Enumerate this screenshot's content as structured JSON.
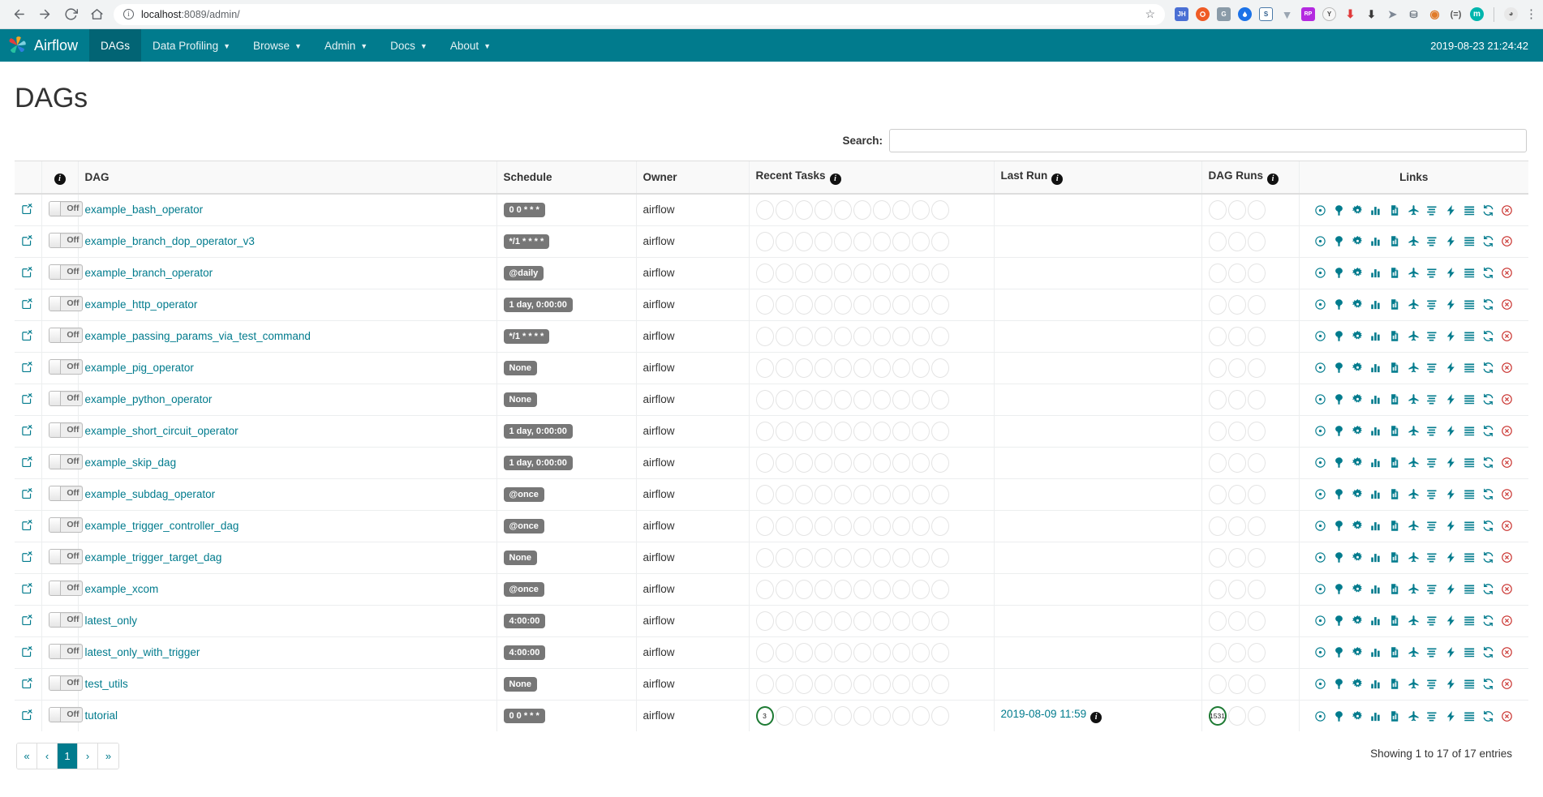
{
  "browser": {
    "back_icon": "back-arrow-icon",
    "forward_icon": "forward-arrow-icon",
    "reload_icon": "reload-icon",
    "home_icon": "home-icon",
    "url_host": "localhost",
    "url_rest": ":8089/admin/",
    "url_full": "localhost:8089/admin/",
    "star_glyph": "☆",
    "kebab_glyph": "⋮",
    "extensions": [
      {
        "name": "extension-jh",
        "label": "JH",
        "color": "#4a6fd4"
      },
      {
        "name": "extension-lifebuoy",
        "label": "",
        "color": "#ef5b25"
      },
      {
        "name": "extension-translate",
        "label": "G",
        "color": "#8a9ba8"
      },
      {
        "name": "extension-blue-drop",
        "label": "",
        "color": "#1b72e8"
      },
      {
        "name": "extension-s",
        "label": "S",
        "color": "#5a7fa6"
      },
      {
        "name": "extension-v",
        "label": "V",
        "color": "#9aa5b1"
      },
      {
        "name": "extension-rp",
        "label": "RP",
        "color": "#b42ae0"
      },
      {
        "name": "extension-y-circle",
        "label": "Y",
        "color": "#f5f5f5"
      },
      {
        "name": "extension-download-arrow",
        "label": "",
        "color": "#e03a3a"
      },
      {
        "name": "extension-dark-arrow",
        "label": "",
        "color": "#3a3a3a"
      },
      {
        "name": "extension-cursor",
        "label": "",
        "color": "#7d8794"
      },
      {
        "name": "extension-sitemap",
        "label": "",
        "color": "#6b7580"
      },
      {
        "name": "extension-eye",
        "label": "",
        "color": "#e07b2a"
      },
      {
        "name": "extension-equals",
        "label": "=",
        "color": "#555555"
      },
      {
        "name": "extension-m-circle",
        "label": "m",
        "color": "#00b5ad"
      }
    ],
    "profile_icon": "profile-avatar-icon"
  },
  "navbar": {
    "brand": "Airflow",
    "items": [
      {
        "label": "DAGs",
        "has_caret": false,
        "active": true,
        "name": "nav-dags"
      },
      {
        "label": "Data Profiling",
        "has_caret": true,
        "active": false,
        "name": "nav-data-profiling"
      },
      {
        "label": "Browse",
        "has_caret": true,
        "active": false,
        "name": "nav-browse"
      },
      {
        "label": "Admin",
        "has_caret": true,
        "active": false,
        "name": "nav-admin"
      },
      {
        "label": "Docs",
        "has_caret": true,
        "active": false,
        "name": "nav-docs"
      },
      {
        "label": "About",
        "has_caret": true,
        "active": false,
        "name": "nav-about"
      }
    ],
    "caret_glyph": "▼",
    "clock": "2019-08-23 21:24:42"
  },
  "page": {
    "title": "DAGs"
  },
  "search": {
    "label": "Search:",
    "value": "",
    "placeholder": ""
  },
  "table": {
    "headers": {
      "edit": "",
      "info": "ⓘ",
      "dag": "DAG",
      "schedule": "Schedule",
      "owner": "Owner",
      "recent_tasks": "Recent Tasks",
      "last_run": "Last Run",
      "dag_runs": "DAG Runs",
      "links": "Links"
    },
    "toggle_label": "Off",
    "recent_task_slots": 10,
    "dag_run_slots": 3,
    "link_icons": [
      {
        "name": "trigger-dag-icon",
        "title": "Trigger Dag",
        "danger": false
      },
      {
        "name": "tree-view-icon",
        "title": "Tree View",
        "danger": false
      },
      {
        "name": "graph-view-icon",
        "title": "Graph View",
        "danger": false
      },
      {
        "name": "task-duration-icon",
        "title": "Task Duration",
        "danger": false
      },
      {
        "name": "task-tries-icon",
        "title": "Task Tries",
        "danger": false
      },
      {
        "name": "landing-times-icon",
        "title": "Landing Times",
        "danger": false
      },
      {
        "name": "gantt-icon",
        "title": "Gantt",
        "danger": false
      },
      {
        "name": "code-icon",
        "title": "Code",
        "danger": false
      },
      {
        "name": "logs-icon",
        "title": "Logs",
        "danger": false
      },
      {
        "name": "refresh-icon",
        "title": "Refresh",
        "danger": false
      },
      {
        "name": "delete-dag-icon",
        "title": "Delete Dag",
        "danger": true
      }
    ],
    "rows": [
      {
        "dag": "example_bash_operator",
        "schedule": "0 0 * * *",
        "owner": "airflow",
        "last_run": "",
        "recent": [],
        "runs": []
      },
      {
        "dag": "example_branch_dop_operator_v3",
        "schedule": "*/1 * * * *",
        "owner": "airflow",
        "last_run": "",
        "recent": [],
        "runs": []
      },
      {
        "dag": "example_branch_operator",
        "schedule": "@daily",
        "owner": "airflow",
        "last_run": "",
        "recent": [],
        "runs": []
      },
      {
        "dag": "example_http_operator",
        "schedule": "1 day, 0:00:00",
        "owner": "airflow",
        "last_run": "",
        "recent": [],
        "runs": []
      },
      {
        "dag": "example_passing_params_via_test_command",
        "schedule": "*/1 * * * *",
        "owner": "airflow",
        "last_run": "",
        "recent": [],
        "runs": []
      },
      {
        "dag": "example_pig_operator",
        "schedule": "None",
        "owner": "airflow",
        "last_run": "",
        "recent": [],
        "runs": []
      },
      {
        "dag": "example_python_operator",
        "schedule": "None",
        "owner": "airflow",
        "last_run": "",
        "recent": [],
        "runs": []
      },
      {
        "dag": "example_short_circuit_operator",
        "schedule": "1 day, 0:00:00",
        "owner": "airflow",
        "last_run": "",
        "recent": [],
        "runs": []
      },
      {
        "dag": "example_skip_dag",
        "schedule": "1 day, 0:00:00",
        "owner": "airflow",
        "last_run": "",
        "recent": [],
        "runs": []
      },
      {
        "dag": "example_subdag_operator",
        "schedule": "@once",
        "owner": "airflow",
        "last_run": "",
        "recent": [],
        "runs": []
      },
      {
        "dag": "example_trigger_controller_dag",
        "schedule": "@once",
        "owner": "airflow",
        "last_run": "",
        "recent": [],
        "runs": []
      },
      {
        "dag": "example_trigger_target_dag",
        "schedule": "None",
        "owner": "airflow",
        "last_run": "",
        "recent": [],
        "runs": []
      },
      {
        "dag": "example_xcom",
        "schedule": "@once",
        "owner": "airflow",
        "last_run": "",
        "recent": [],
        "runs": []
      },
      {
        "dag": "latest_only",
        "schedule": "4:00:00",
        "owner": "airflow",
        "last_run": "",
        "recent": [],
        "runs": []
      },
      {
        "dag": "latest_only_with_trigger",
        "schedule": "4:00:00",
        "owner": "airflow",
        "last_run": "",
        "recent": [],
        "runs": []
      },
      {
        "dag": "test_utils",
        "schedule": "None",
        "owner": "airflow",
        "last_run": "",
        "recent": [],
        "runs": []
      },
      {
        "dag": "tutorial",
        "schedule": "0 0 * * *",
        "owner": "airflow",
        "last_run": "2019-08-09 11:59",
        "recent": [
          {
            "index": 0,
            "value": "3"
          }
        ],
        "runs": [
          {
            "index": 0,
            "value": "1531"
          }
        ]
      }
    ]
  },
  "footer": {
    "entries": "Showing 1 to 17 of 17 entries",
    "pagination": [
      {
        "label": "«",
        "name": "page-first",
        "active": false
      },
      {
        "label": "‹",
        "name": "page-prev",
        "active": false
      },
      {
        "label": "1",
        "name": "page-1",
        "active": true
      },
      {
        "label": "›",
        "name": "page-next",
        "active": false
      },
      {
        "label": "»",
        "name": "page-last",
        "active": false
      }
    ]
  },
  "colors": {
    "brand_teal": "#017b8d",
    "nav_active": "#026474",
    "link_teal": "#017b8d",
    "danger_red": "#c9302c",
    "badge_gray": "#777777",
    "success_green": "#1d7a33"
  }
}
